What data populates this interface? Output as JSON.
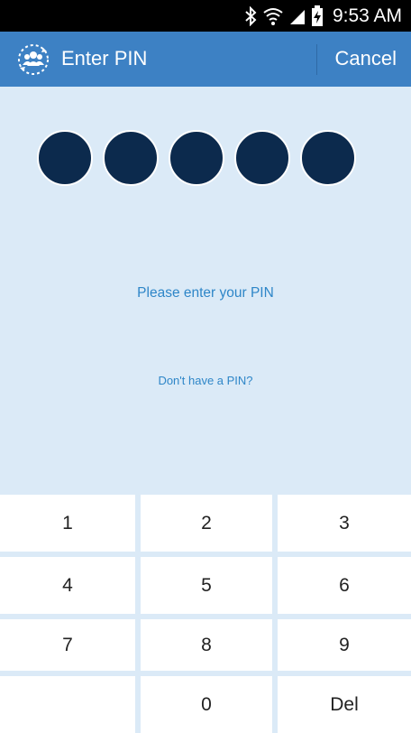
{
  "status_bar": {
    "time": "9:53 AM",
    "icons": [
      "bluetooth-icon",
      "wifi-icon",
      "signal-icon",
      "battery-charging-icon"
    ]
  },
  "app_bar": {
    "logo_icon": "people-sync-icon",
    "title": "Enter PIN",
    "cancel_label": "Cancel",
    "background_color": "#3d81c4"
  },
  "pin": {
    "dot_count": 5,
    "dot_color": "#0c2a4d",
    "prompt": "Please enter your PIN",
    "no_pin_link": "Don't have a PIN?"
  },
  "keypad": {
    "keys": [
      "1",
      "2",
      "3",
      "4",
      "5",
      "6",
      "7",
      "8",
      "9",
      "",
      "0",
      "Del"
    ]
  },
  "colors": {
    "accent": "#3d81c4",
    "background": "#dbeaf7",
    "link": "#2e86c8"
  }
}
